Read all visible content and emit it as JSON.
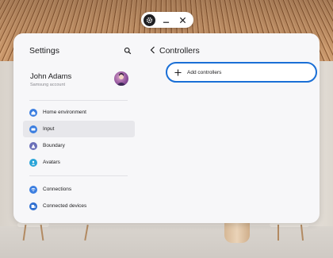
{
  "window_controls": {
    "app_icon": "settings-app-icon",
    "minimize_icon": "minimize-icon",
    "close_icon": "close-icon"
  },
  "sidebar": {
    "title": "Settings",
    "search_icon": "search-icon",
    "account": {
      "name": "John Adams",
      "subtitle": "Samsung account"
    },
    "items": [
      {
        "label": "Home environment",
        "icon": "home-icon",
        "color": "#3b7ee0",
        "selected": false
      },
      {
        "label": "Input",
        "icon": "input-icon",
        "color": "#3b7ee0",
        "selected": true
      },
      {
        "label": "Boundary",
        "icon": "boundary-icon",
        "color": "#6a6fb8",
        "selected": false
      },
      {
        "label": "Avatars",
        "icon": "avatar-icon",
        "color": "#2aa5d8",
        "selected": false
      }
    ],
    "items2": [
      {
        "label": "Connections",
        "icon": "wifi-icon",
        "color": "#3b7ee0",
        "selected": false
      },
      {
        "label": "Connected devices",
        "icon": "devices-icon",
        "color": "#2f6fd0",
        "selected": false
      }
    ]
  },
  "main": {
    "title": "Controllers",
    "add_button_label": "Add controllers"
  },
  "colors": {
    "accent": "#1a6fd6",
    "selected_bg": "#e7e7eb",
    "window_bg": "#f7f7f9"
  }
}
